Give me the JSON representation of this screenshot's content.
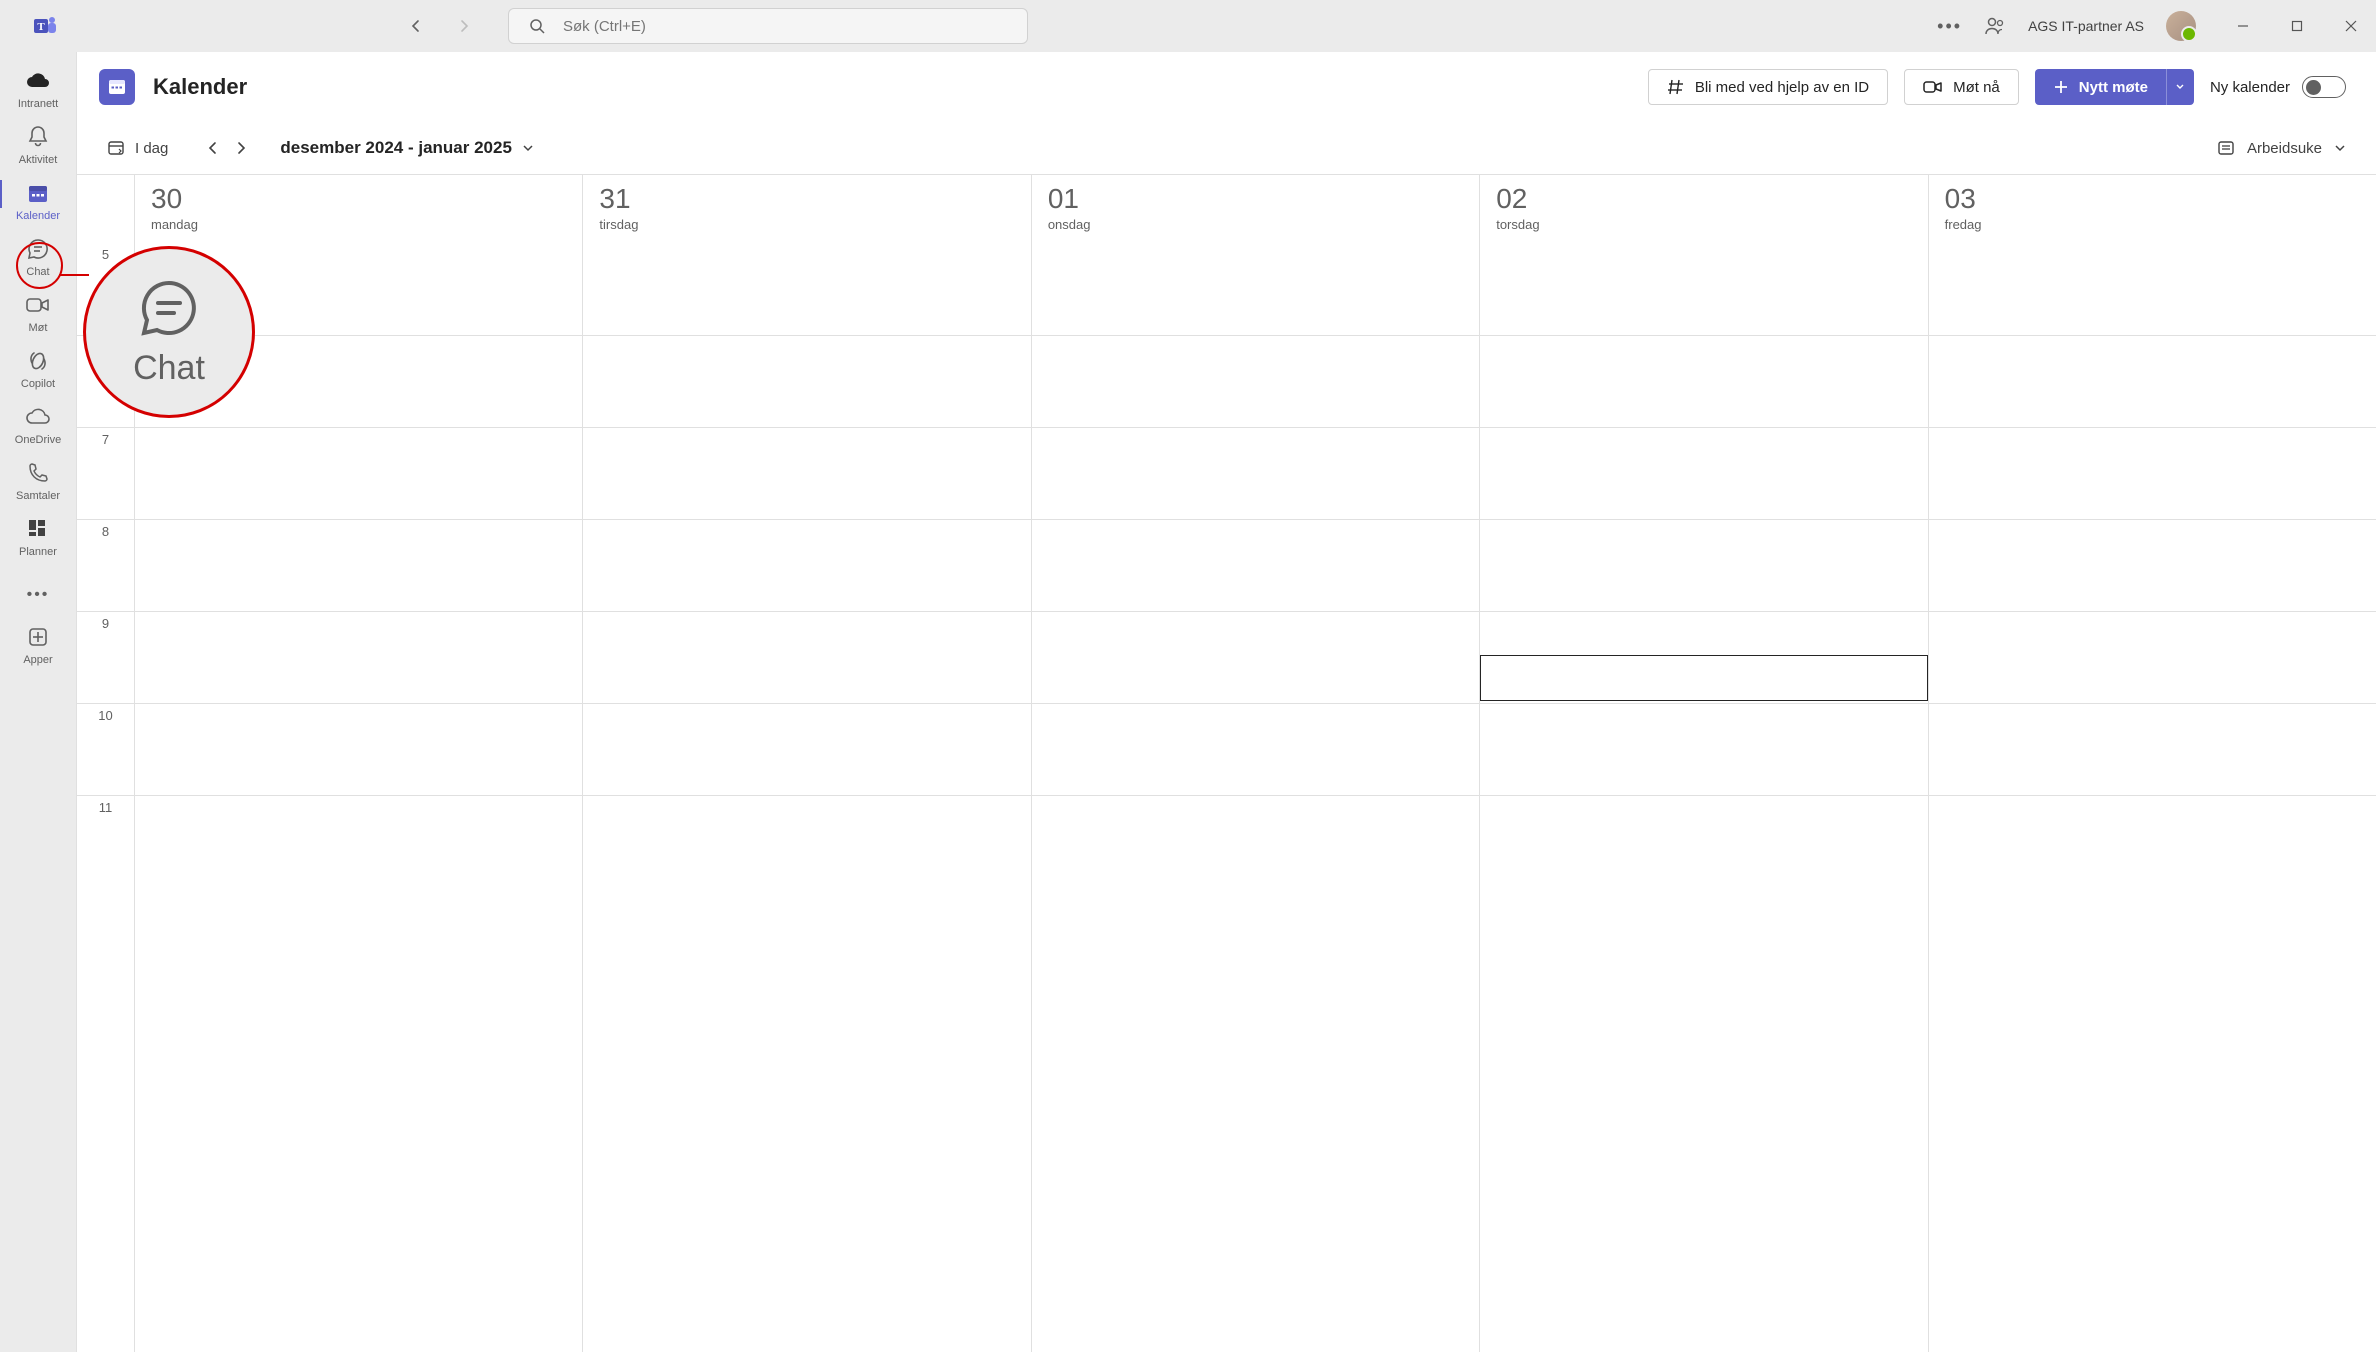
{
  "titlebar": {
    "search_placeholder": "Søk (Ctrl+E)",
    "org": "AGS IT-partner AS"
  },
  "rail": {
    "items": [
      {
        "id": "intranett",
        "label": "Intranett"
      },
      {
        "id": "aktivitet",
        "label": "Aktivitet"
      },
      {
        "id": "kalender",
        "label": "Kalender",
        "active": true
      },
      {
        "id": "chat",
        "label": "Chat"
      },
      {
        "id": "mot",
        "label": "Møt"
      },
      {
        "id": "copilot",
        "label": "Copilot"
      },
      {
        "id": "onedrive",
        "label": "OneDrive"
      },
      {
        "id": "samtaler",
        "label": "Samtaler"
      },
      {
        "id": "planner",
        "label": "Planner"
      }
    ],
    "apps_label": "Apper"
  },
  "header": {
    "title": "Kalender",
    "join_label": "Bli med ved hjelp av en ID",
    "meet_now_label": "Møt nå",
    "new_meeting_label": "Nytt møte",
    "new_calendar_label": "Ny kalender"
  },
  "subheader": {
    "today_label": "I dag",
    "range": "desember 2024 - januar 2025",
    "view_label": "Arbeidsuke"
  },
  "days": [
    {
      "num": "30",
      "name": "mandag"
    },
    {
      "num": "31",
      "name": "tirsdag"
    },
    {
      "num": "01",
      "name": "onsdag"
    },
    {
      "num": "02",
      "name": "torsdag"
    },
    {
      "num": "03",
      "name": "fredag"
    }
  ],
  "hours": [
    "5",
    "",
    "7",
    "8",
    "9",
    "10",
    "11"
  ],
  "callout": {
    "label": "Chat"
  }
}
